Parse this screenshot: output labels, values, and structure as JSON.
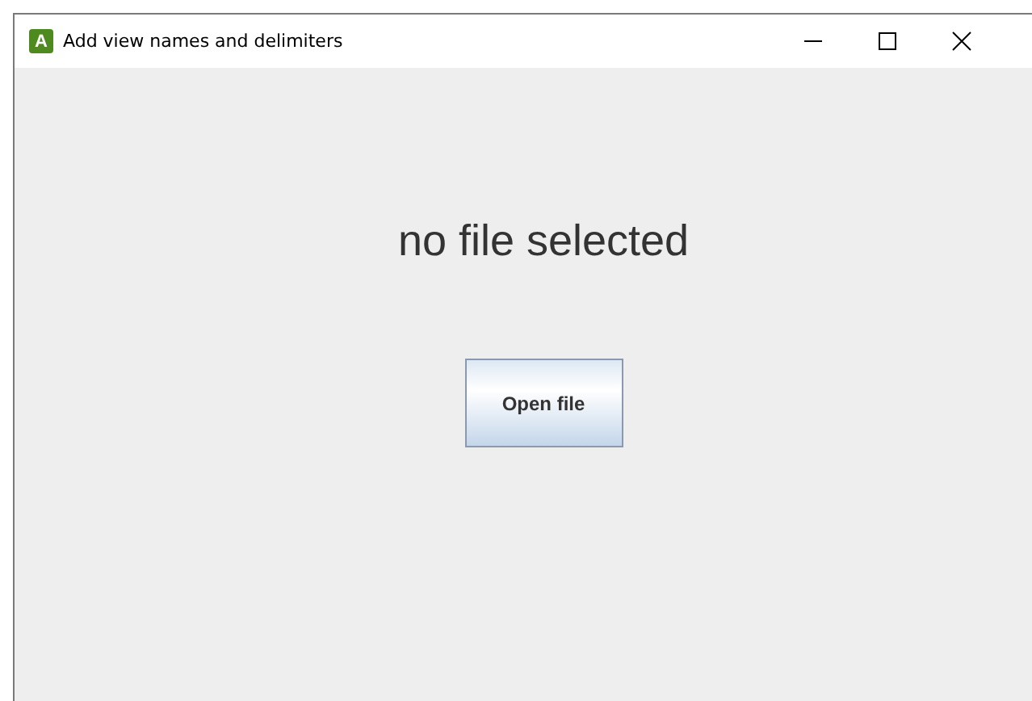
{
  "window": {
    "icon_letter": "A",
    "title": "Add view names and delimiters"
  },
  "content": {
    "status": "no file selected",
    "button": "Open file"
  }
}
